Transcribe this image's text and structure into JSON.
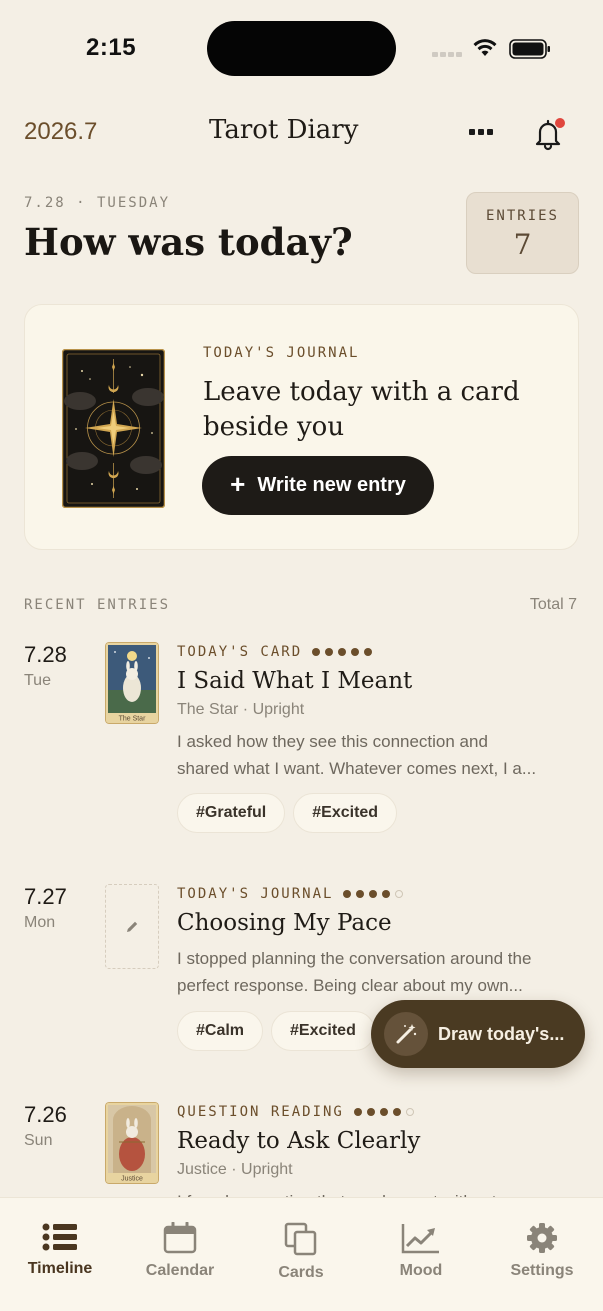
{
  "status_bar": {
    "time": "2:15"
  },
  "header": {
    "month": "2026.7",
    "title": "Tarot Diary"
  },
  "greeting": {
    "date": "7.28 · TUESDAY",
    "title": "How was today?"
  },
  "entries_box": {
    "label": "ENTRIES",
    "count": "7"
  },
  "journal_card": {
    "kicker": "TODAY'S JOURNAL",
    "text": "Leave today with a card beside you",
    "button_label": "Write new entry",
    "card_art": "star-compass-tarot-card"
  },
  "recent": {
    "label": "RECENT ENTRIES",
    "total": "Total 7"
  },
  "entries": [
    {
      "day": "7.28",
      "weekday": "Tue",
      "kicker": "TODAY'S CARD",
      "rating": 5,
      "title": "I Said What I Meant",
      "sub": "The Star · Upright",
      "thumb_label": "The Star",
      "body_line1": "I asked how they see this connection and",
      "body_line2": "shared what I want. Whatever comes next, I a...",
      "tags": [
        "#Grateful",
        "#Excited"
      ]
    },
    {
      "day": "7.27",
      "weekday": "Mon",
      "kicker": "TODAY'S JOURNAL",
      "rating": 4,
      "title": "Choosing My Pace",
      "body_line1": "I stopped planning the conversation around the",
      "body_line2": "perfect response. Being clear about my own...",
      "tags": [
        "#Calm",
        "#Excited"
      ]
    },
    {
      "day": "7.26",
      "weekday": "Sun",
      "kicker": "QUESTION READING",
      "rating": 4,
      "title": "Ready to Ask Clearly",
      "sub": "Justice · Upright",
      "thumb_label": "Justice",
      "body_line1": "I found a question that can be sent without"
    }
  ],
  "fab": {
    "label": "Draw today's..."
  },
  "tabs": [
    {
      "label": "Timeline",
      "icon": "list-icon"
    },
    {
      "label": "Calendar",
      "icon": "calendar-icon"
    },
    {
      "label": "Cards",
      "icon": "cards-icon"
    },
    {
      "label": "Mood",
      "icon": "chart-icon"
    },
    {
      "label": "Settings",
      "icon": "gear-icon"
    }
  ],
  "colors": {
    "accent": "#6b4e2b",
    "background": "#f4efe5",
    "fab": "#4a3a22",
    "notification": "#e0463d"
  }
}
